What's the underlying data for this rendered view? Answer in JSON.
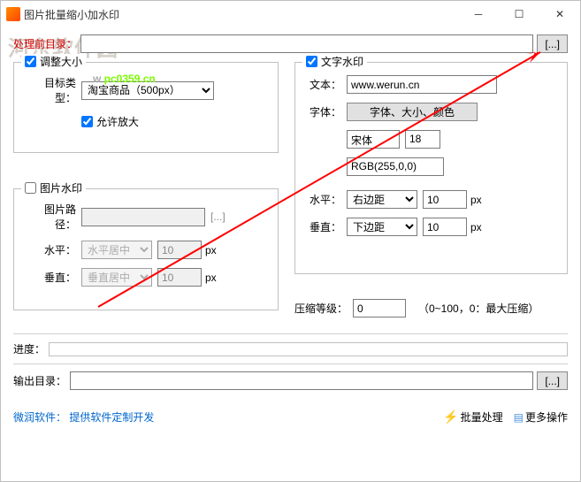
{
  "titlebar": {
    "title": "图片批量缩小加水印"
  },
  "watermark": {
    "site1": "河东软件园",
    "site2": "pc0359.cn"
  },
  "input_dir": {
    "label": "处理前目录：",
    "value": "",
    "browse": "[...]"
  },
  "resize": {
    "check_label": "调整大小",
    "target_label": "目标类型：",
    "target_value": "淘宝商品（500px）",
    "allow_enlarge": "允许放大"
  },
  "img_wm": {
    "check_label": "图片水印",
    "path_label": "图片路径：",
    "path_value": "",
    "browse": "[...]",
    "h_label": "水平：",
    "h_value": "水平居中",
    "h_px": "10",
    "h_unit": "px",
    "v_label": "垂直：",
    "v_value": "垂直居中",
    "v_px": "10",
    "v_unit": "px"
  },
  "txt_wm": {
    "check_label": "文字水印",
    "text_label": "文本：",
    "text_value": "www.werun.cn",
    "font_label": "字体：",
    "font_btn": "字体、大小、颜色",
    "font_name": "宋体",
    "font_size": "18",
    "font_color": "RGB(255,0,0)",
    "h_label": "水平：",
    "h_value": "右边距",
    "h_px": "10",
    "h_unit": "px",
    "v_label": "垂直：",
    "v_value": "下边距",
    "v_px": "10",
    "v_unit": "px"
  },
  "compress": {
    "label": "压缩等级：",
    "value": "0",
    "hint": "（0~100，0：最大压缩）"
  },
  "progress": {
    "label": "进度："
  },
  "output": {
    "label": "输出目录：",
    "value": "",
    "browse": "[...]"
  },
  "footer": {
    "brand": "微润软件：",
    "slogan": "提供软件定制开发",
    "batch": "批量处理",
    "more": "更多操作"
  }
}
